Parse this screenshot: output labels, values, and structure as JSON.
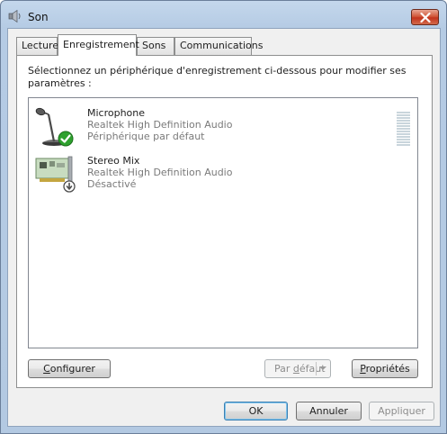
{
  "window": {
    "title": "Son",
    "close_icon": "close-icon"
  },
  "tabs": [
    {
      "label": "Lecture",
      "active": false
    },
    {
      "label": "Enregistrement",
      "active": true
    },
    {
      "label": "Sons",
      "active": false
    },
    {
      "label": "Communications",
      "active": false
    }
  ],
  "panel": {
    "instructions": "Sélectionnez un périphérique d'enregistrement ci-dessous pour modifier ses paramètres :"
  },
  "devices": [
    {
      "name": "Microphone",
      "driver": "Realtek High Definition Audio",
      "status": "Périphérique par défaut",
      "icon": "microphone-icon",
      "badge": "default-checkmark-icon"
    },
    {
      "name": "Stereo Mix",
      "driver": "Realtek High Definition Audio",
      "status": "Désactivé",
      "icon": "sound-card-icon",
      "badge": "disabled-arrow-icon"
    }
  ],
  "buttons": {
    "configure": {
      "mnemonic": "C",
      "rest": "onfigurer"
    },
    "set_default": {
      "pre": "Par ",
      "mnemonic": "d",
      "rest": "éfaut"
    },
    "properties": {
      "mnemonic": "P",
      "rest": "ropriétés"
    },
    "ok": "OK",
    "cancel": "Annuler",
    "apply": "Appliquer"
  },
  "colors": {
    "titlebar": "#c4d7ec",
    "close_button": "#c3341d",
    "checkmark": "#2ea12e",
    "disabled_text": "#8d8d8d"
  }
}
